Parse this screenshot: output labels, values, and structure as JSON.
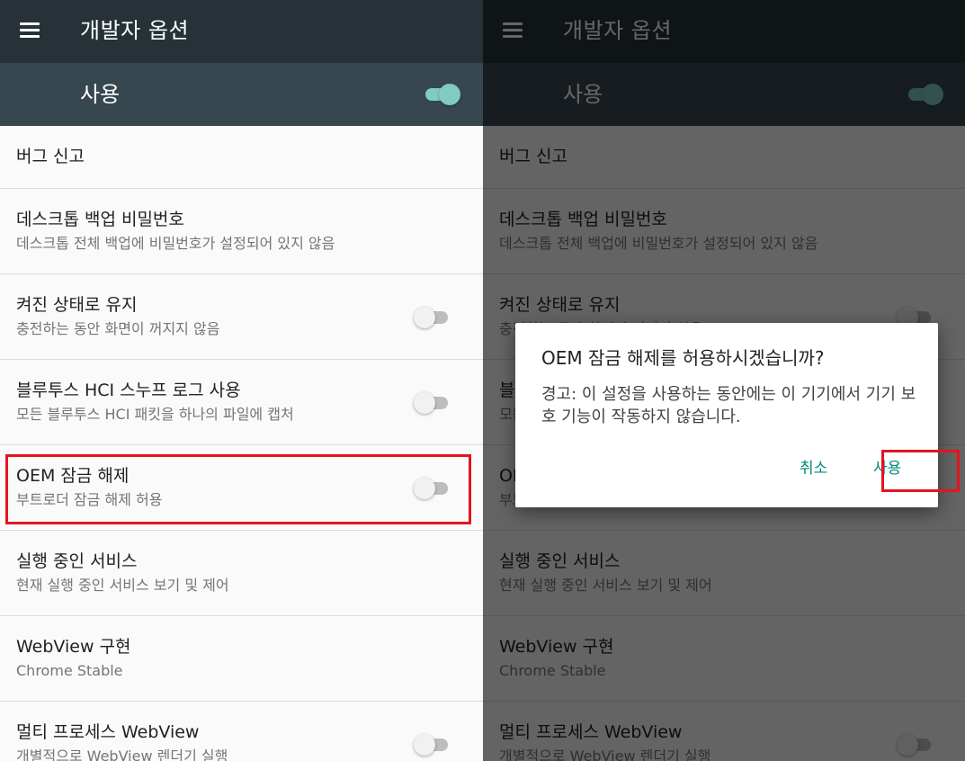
{
  "appbar": {
    "title": "개발자 옵션",
    "menu_icon": "hamburger-menu-icon"
  },
  "master": {
    "label": "사용",
    "enabled": true
  },
  "items": [
    {
      "title": "버그 신고",
      "subtitle": "",
      "toggle": false
    },
    {
      "title": "데스크톱 백업 비밀번호",
      "subtitle": "데스크톱 전체 백업에 비밀번호가 설정되어 있지 않음",
      "toggle": false
    },
    {
      "title": "켜진 상태로 유지",
      "subtitle": "충전하는 동안 화면이 꺼지지 않음",
      "toggle": true,
      "checked": false
    },
    {
      "title": "블루투스 HCI 스누프 로그 사용",
      "subtitle": "모든 블루투스 HCI 패킷을 하나의 파일에 캡처",
      "toggle": true,
      "checked": false
    },
    {
      "title": "OEM 잠금 해제",
      "subtitle": "부트로더 잠금 해제 허용",
      "toggle": true,
      "checked": false
    },
    {
      "title": "실행 중인 서비스",
      "subtitle": "현재 실행 중인 서비스 보기 및 제어",
      "toggle": false
    },
    {
      "title": "WebView 구현",
      "subtitle": "Chrome Stable",
      "toggle": false
    },
    {
      "title": "멀티 프로세스 WebView",
      "subtitle": "개별적으로 WebView 렌더기 실행",
      "toggle": true,
      "checked": false
    }
  ],
  "dialog": {
    "title": "OEM 잠금 해제를 허용하시겠습니까?",
    "message": "경고: 이 설정을 사용하는 동안에는 이 기기에서 기기 보호 기능이 작동하지 않습니다.",
    "cancel_label": "취소",
    "confirm_label": "사용"
  },
  "colors": {
    "appbar": "#263238",
    "master_bar": "#37474f",
    "accent": "#80cbc4",
    "dialog_button": "#00897b",
    "highlight": "#e5141f"
  }
}
